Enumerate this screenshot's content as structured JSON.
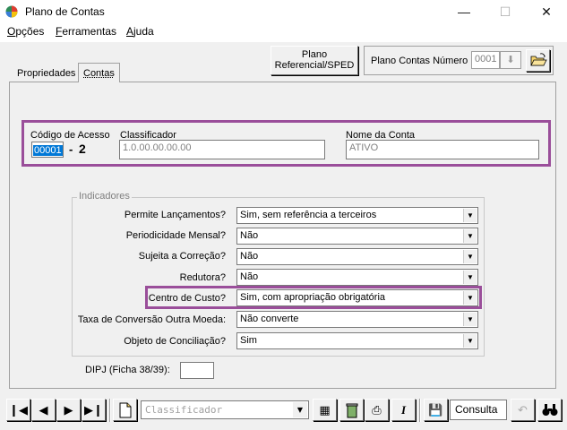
{
  "window": {
    "title": "Plano de Contas"
  },
  "menu": [
    {
      "label": "Opções",
      "u": "O",
      "rest": "pções"
    },
    {
      "label": "Ferramentas",
      "u": "F",
      "rest": "erramentas"
    },
    {
      "label": "Ajuda",
      "u": "A",
      "rest": "juda"
    }
  ],
  "toolbar": {
    "ref_line1": "Plano",
    "ref_line2": "Referencial/SPED",
    "plano_label": "Plano Contas Número",
    "plano_value": "0001"
  },
  "tabs": [
    "Propriedades",
    "Contas"
  ],
  "account": {
    "codigo_label": "Código de Acesso",
    "codigo_value": "00001",
    "codigo_dash": "-",
    "codigo_digit": "2",
    "classificador_label": "Classificador",
    "classificador_value": "1.0.00.00.00.00",
    "nome_label": "Nome da Conta",
    "nome_value": "ATIVO"
  },
  "indicadores": {
    "title": "Indicadores",
    "rows": [
      {
        "label": "Permite Lançamentos?",
        "value": "Sim, sem referência a terceiros"
      },
      {
        "label": "Periodicidade Mensal?",
        "value": "Não"
      },
      {
        "label": "Sujeita a Correção?",
        "value": "Não"
      },
      {
        "label": "Redutora?",
        "value": "Não"
      },
      {
        "label": "Centro de Custo?",
        "value": "Sim, com apropriação obrigatória"
      },
      {
        "label": "Taxa de Conversão Outra Moeda:",
        "value": "Não converte"
      },
      {
        "label": "Objeto de Conciliação?",
        "value": "Sim"
      }
    ]
  },
  "dipj": {
    "label": "DIPJ (Ficha 38/39):",
    "value": ""
  },
  "bottom": {
    "classificador_placeholder": "Classificador",
    "consulta_label": "Consulta"
  },
  "colors": {
    "highlight": "#9a4e9a",
    "selection": "#0078d7"
  }
}
